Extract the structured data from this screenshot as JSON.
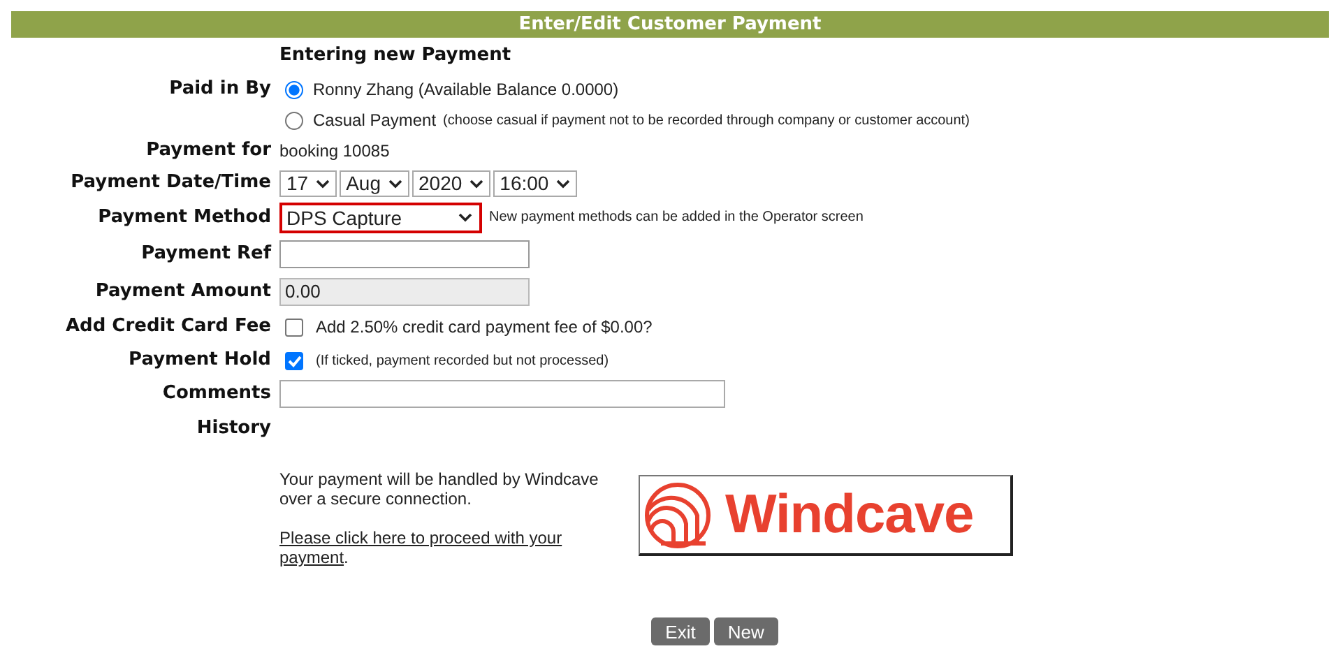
{
  "header": {
    "title": "Enter/Edit Customer Payment"
  },
  "subtitle": "Entering new Payment",
  "fields": [
    {
      "kind": "radio",
      "label": "Paid in By",
      "options": [
        {
          "text": "Ronny Zhang (Available Balance 0.0000)",
          "selected": true
        },
        {
          "text": "Casual Payment",
          "note": "(choose casual if payment not to be recorded through company or customer account)",
          "selected": false
        }
      ]
    },
    {
      "kind": "text",
      "label": "Payment for",
      "value": "booking 10085"
    },
    {
      "kind": "selects",
      "label": "Payment Date/Time",
      "selects": [
        "17",
        "Aug",
        "2020",
        "16:00"
      ]
    },
    {
      "kind": "select",
      "label": "Payment Method",
      "value": "DPS Capture",
      "highlighted": true,
      "note": "New payment methods can be added in the Operator screen"
    },
    {
      "kind": "input",
      "label": "Payment Ref",
      "disabled": false
    },
    {
      "kind": "input",
      "label": "Payment Amount",
      "value": "0.00",
      "disabled": true
    },
    {
      "kind": "checkbox",
      "label": "Add Credit Card Fee",
      "checked": false,
      "text": "Add 2.50% credit card payment fee of $0.00?"
    },
    {
      "kind": "checkbox",
      "label": "Payment Hold",
      "checked": true,
      "note": "(If ticked, payment recorded but not processed)"
    },
    {
      "kind": "comment",
      "label": "Comments"
    },
    {
      "kind": "heading",
      "label": "History"
    }
  ],
  "gateway": {
    "message": "Your payment will be handled by Windcave over a secure connection.",
    "link": "Please click here to proceed with your payment",
    "link_suffix": ".",
    "logo": "Windcave"
  },
  "buttons": [
    "Exit",
    "New"
  ]
}
